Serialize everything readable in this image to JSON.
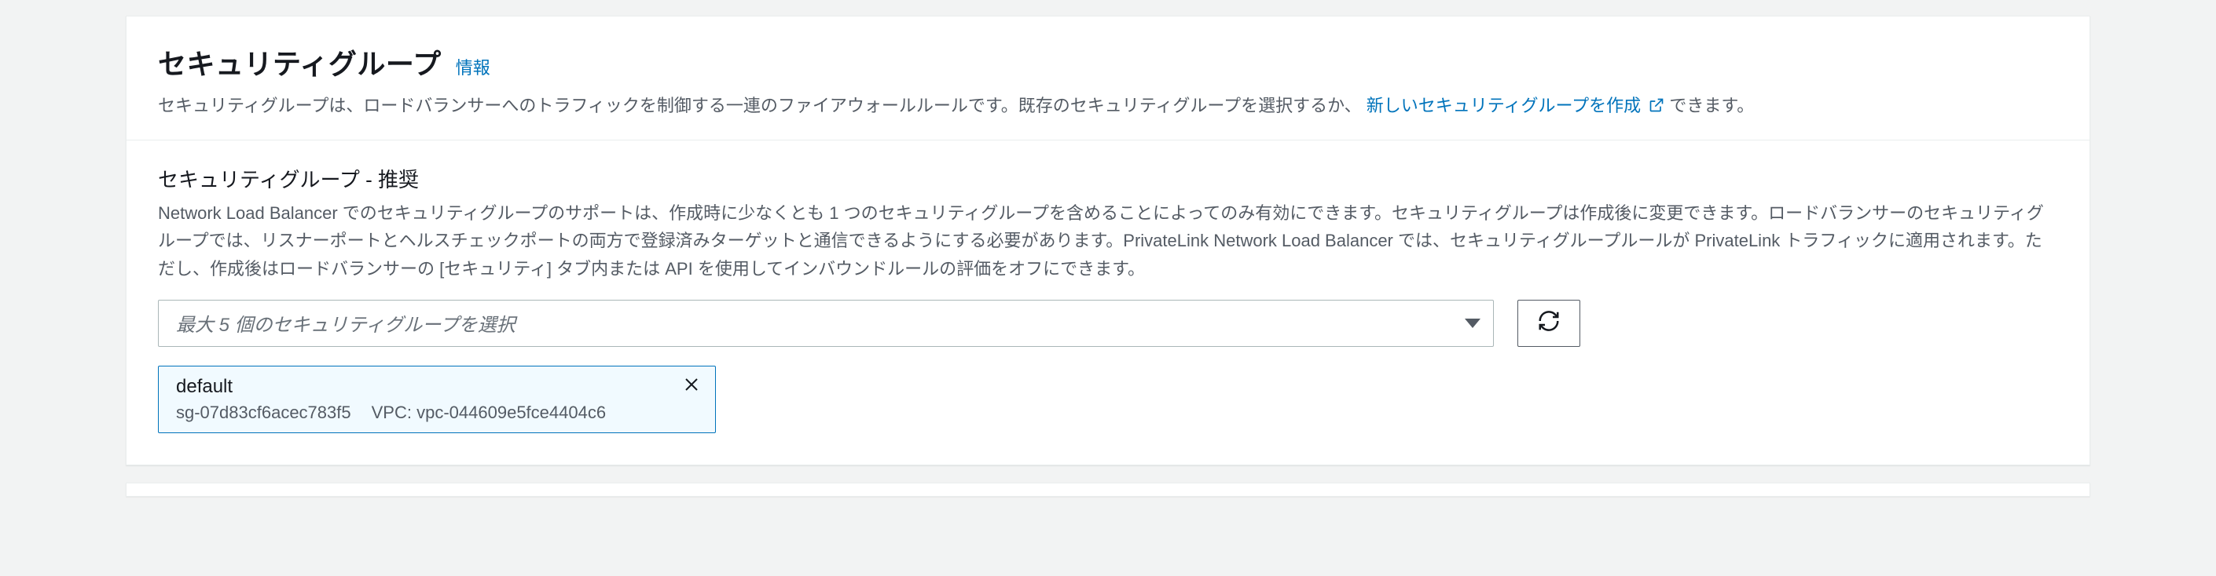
{
  "header": {
    "title": "セキュリティグループ",
    "info_link": "情報",
    "desc_before_link": "セキュリティグループは、ロードバランサーへのトラフィックを制御する一連のファイアウォールルールです。既存のセキュリティグループを選択するか、",
    "create_link": "新しいセキュリティグループを作成",
    "desc_after_link": "できます。"
  },
  "body": {
    "subtitle": "セキュリティグループ - 推奨",
    "description": "Network Load Balancer でのセキュリティグループのサポートは、作成時に少なくとも 1 つのセキュリティグループを含めることによってのみ有効にできます。セキュリティグループは作成後に変更できます。ロードバランサーのセキュリティグループでは、リスナーポートとヘルスチェックポートの両方で登録済みターゲットと通信できるようにする必要があります。PrivateLink Network Load Balancer では、セキュリティグループルールが PrivateLink トラフィックに適用されます。ただし、作成後はロードバランサーの [セキュリティ] タブ内または API を使用してインバウンドルールの評価をオフにできます。",
    "dropdown_placeholder": "最大 5 個のセキュリティグループを選択"
  },
  "selected": {
    "name": "default",
    "sg_id": "sg-07d83cf6acec783f5",
    "vpc_label": "VPC:",
    "vpc_id": "vpc-044609e5fce4404c6"
  }
}
